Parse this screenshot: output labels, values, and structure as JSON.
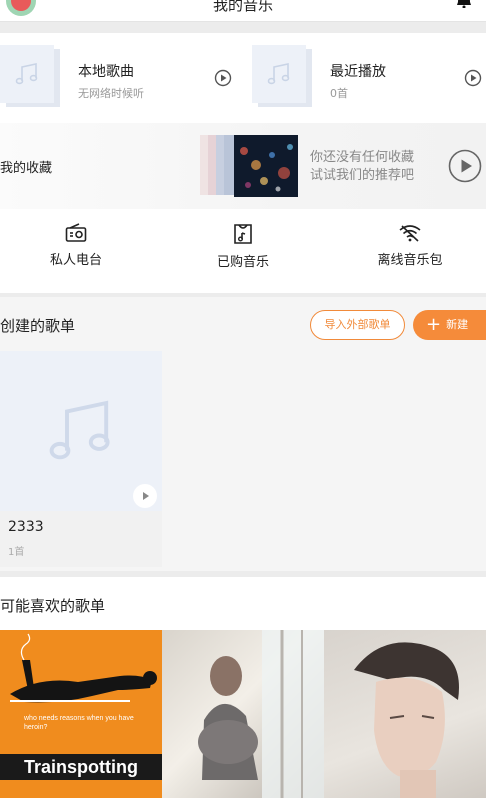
{
  "header": {
    "title": "我的音乐"
  },
  "quick": [
    {
      "title": "本地歌曲",
      "subtitle": "无网络时候听"
    },
    {
      "title": "最近播放",
      "subtitle": "0首"
    }
  ],
  "favorites": {
    "label": "我的收藏",
    "hint_line1": "你还没有任何收藏",
    "hint_line2": "试试我们的推荐吧"
  },
  "actions": [
    {
      "label": "私人电台",
      "icon": "radio-icon"
    },
    {
      "label": "已购音乐",
      "icon": "purchased-music-icon"
    },
    {
      "label": "离线音乐包",
      "icon": "offline-package-icon"
    }
  ],
  "created": {
    "title": "创建的歌单",
    "import_label": "导入外部歌单",
    "new_label": "新建",
    "playlists": [
      {
        "name": "2333",
        "count": "1首"
      }
    ]
  },
  "recommend": {
    "title": "可能喜欢的歌单",
    "cover1_text": "Trainspotting",
    "cover1_tag": "who needs reasons when you have heroin?"
  },
  "colors": {
    "accent": "#f58b3a",
    "placeholder": "#edf1f8"
  }
}
